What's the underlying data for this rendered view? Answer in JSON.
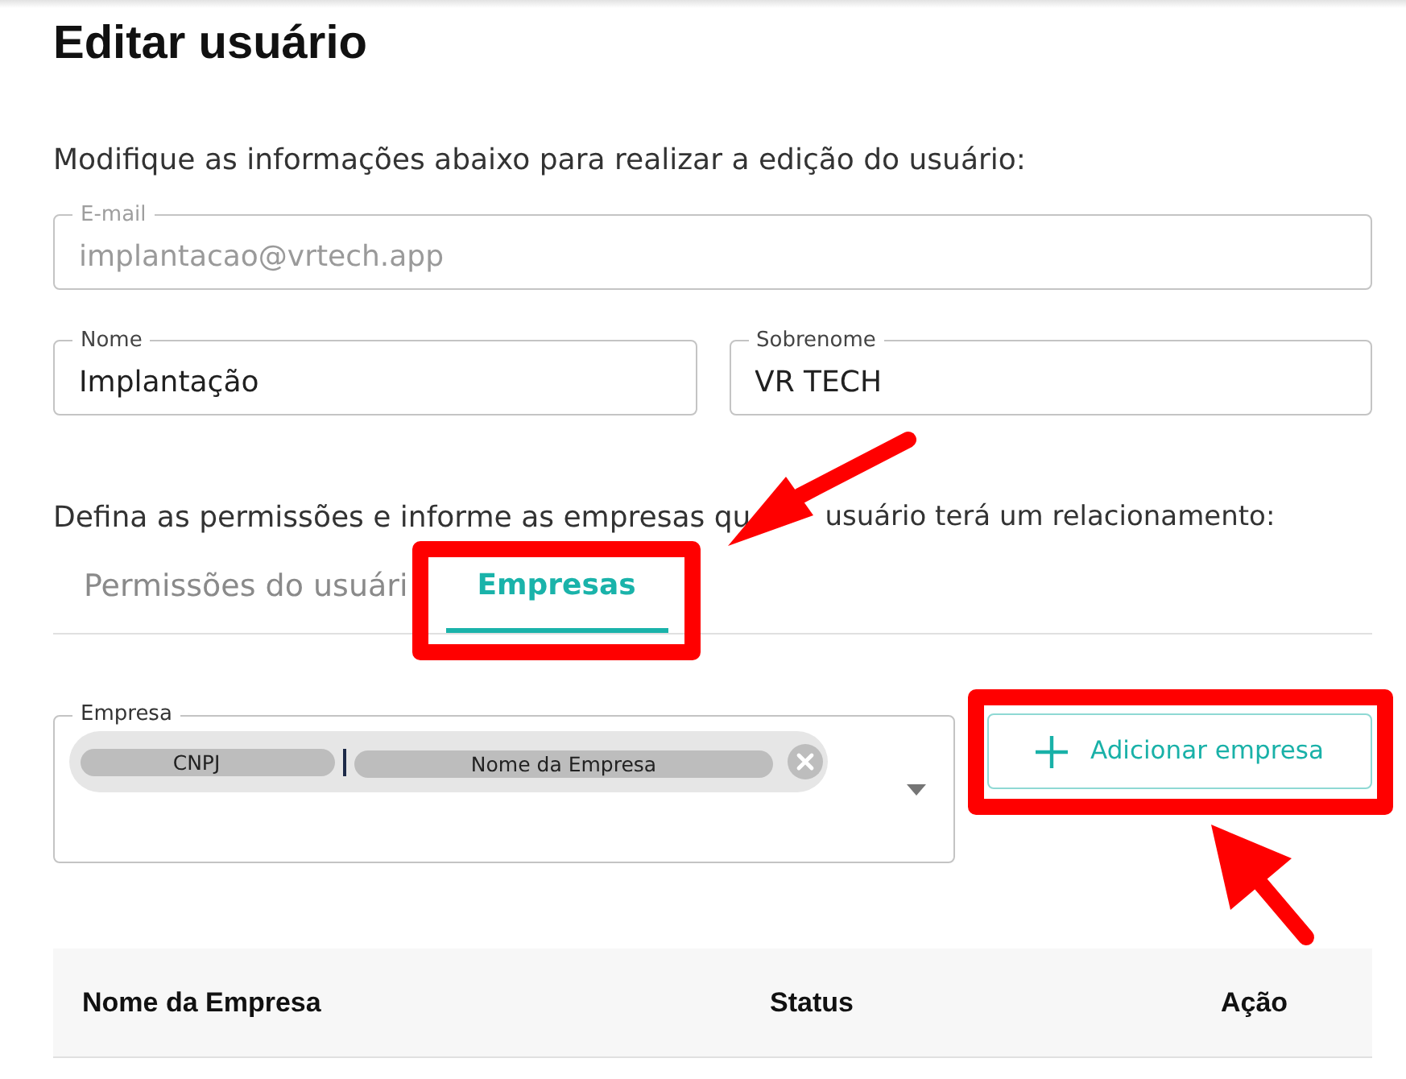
{
  "page": {
    "title": "Editar usuário",
    "intro": "Modifique as informações abaixo para realizar a edição do usuário:"
  },
  "email": {
    "label": "E-mail",
    "value": "implantacao@vrtech.app",
    "disabled": true
  },
  "name_row": [
    {
      "label": "Nome",
      "value": "Implantação",
      "disabled": false
    },
    {
      "label": "Sobrenome",
      "value": "VR TECH",
      "disabled": false
    }
  ],
  "instructions": [
    "Defina as permissões e informe as empresas qu",
    "usuário terá um relacionamento:"
  ],
  "tabs": [
    {
      "label": "Permissões do usuári",
      "selected": false
    },
    {
      "label": "Empresas",
      "selected": true
    }
  ],
  "company_select": {
    "label": "Empresa",
    "chips": [
      {
        "cnpj": "CNPJ",
        "name": "Nome da Empresa"
      }
    ]
  },
  "add_button": {
    "label": "Adicionar empresa"
  },
  "table": {
    "columns": [
      "Nome da Empresa",
      "Status",
      "Ação"
    ]
  }
}
